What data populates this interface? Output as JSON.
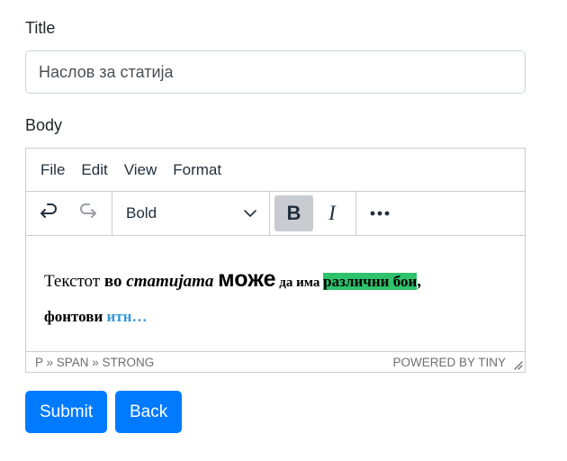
{
  "form": {
    "title_label": "Title",
    "title_value": "Наслов за статија",
    "body_label": "Body"
  },
  "editor": {
    "menu": [
      "File",
      "Edit",
      "View",
      "Format"
    ],
    "toolbar": {
      "undo_icon": "undo-icon",
      "redo_icon": "redo-icon",
      "block_format": "Bold",
      "bold_label": "B",
      "italic_label": "I",
      "more_icon": "more-icon",
      "bold_active": true
    },
    "content": {
      "line1": [
        {
          "text": "Текстот ",
          "style": "plain"
        },
        {
          "text": "во ",
          "style": "bold"
        },
        {
          "text": "статијата ",
          "style": "bold-italic"
        },
        {
          "text": "може",
          "style": "bold-large-sans"
        },
        {
          "text": " да има ",
          "style": "bold-small"
        },
        {
          "text": "различни бои",
          "style": "bold-highlight"
        },
        {
          "text": ",",
          "style": "bold"
        }
      ],
      "line2": [
        {
          "text": "фонтови ",
          "style": "bold"
        },
        {
          "text": "итн…",
          "style": "bold-blue"
        }
      ],
      "highlight_color": "#2dc26b",
      "link_color": "#3598db"
    },
    "statusbar": {
      "path": "P » SPAN » STRONG",
      "brand": "POWERED BY TINY"
    }
  },
  "buttons": {
    "submit": "Submit",
    "back": "Back",
    "color": "#007bff"
  }
}
